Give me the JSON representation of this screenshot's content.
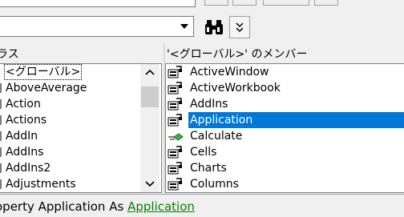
{
  "toolbar": {
    "library_combo": {
      "value": ""
    },
    "search_icon": "binoculars-icon",
    "toggle_icon": "double-chevron-down-icon"
  },
  "classes": {
    "header": "ラス",
    "items": [
      {
        "label": "<グローバル>",
        "selected": true
      },
      {
        "label": "AboveAverage"
      },
      {
        "label": "Action"
      },
      {
        "label": "Actions"
      },
      {
        "label": "AddIn"
      },
      {
        "label": "AddIns"
      },
      {
        "label": "AddIns2"
      },
      {
        "label": "Adjustments"
      }
    ]
  },
  "members": {
    "header": "'<グローバル>' のメンバー",
    "items": [
      {
        "label": "ActiveWindow",
        "icon": "property-icon"
      },
      {
        "label": "ActiveWorkbook",
        "icon": "property-icon"
      },
      {
        "label": "AddIns",
        "icon": "property-icon"
      },
      {
        "label": "Application",
        "icon": "property-icon",
        "selected": true
      },
      {
        "label": "Calculate",
        "icon": "method-icon"
      },
      {
        "label": "Cells",
        "icon": "property-icon"
      },
      {
        "label": "Charts",
        "icon": "property-icon"
      },
      {
        "label": "Columns",
        "icon": "property-icon"
      }
    ]
  },
  "details": {
    "prefix": "operty ",
    "name": "Application",
    "middle": " As ",
    "type_link": "Application"
  },
  "colors": {
    "selection": "#0078d7",
    "link": "#008000"
  }
}
